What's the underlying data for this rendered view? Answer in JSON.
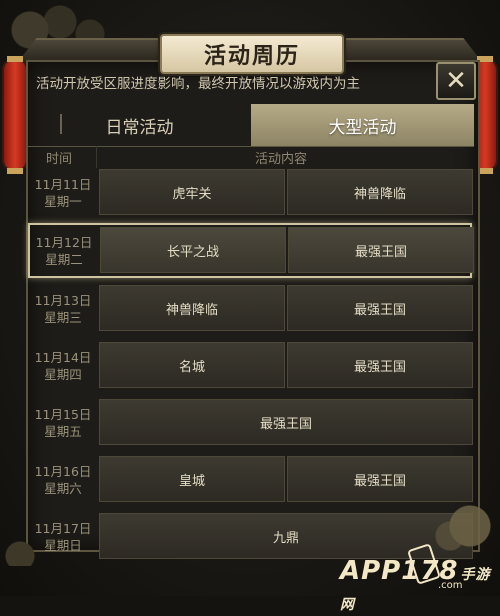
{
  "title": "活动周历",
  "notice": "活动开放受区服进度影响，最终开放情况以游戏内为主",
  "close_icon": "close-x-icon",
  "tabs": [
    {
      "label": "日常活动",
      "active": false
    },
    {
      "label": "大型活动",
      "active": true
    }
  ],
  "headers": {
    "time": "时间",
    "content": "活动内容"
  },
  "rows": [
    {
      "date": "11月11日",
      "weekday": "星期一",
      "events": [
        "虎牢关",
        "神兽降临"
      ]
    },
    {
      "date": "11月12日",
      "weekday": "星期二",
      "events": [
        "长平之战",
        "最强王国"
      ],
      "highlight": true
    },
    {
      "date": "11月13日",
      "weekday": "星期三",
      "events": [
        "神兽降临",
        "最强王国"
      ]
    },
    {
      "date": "11月14日",
      "weekday": "星期四",
      "events": [
        "名城",
        "最强王国"
      ]
    },
    {
      "date": "11月15日",
      "weekday": "星期五",
      "events": [
        "最强王国"
      ]
    },
    {
      "date": "11月16日",
      "weekday": "星期六",
      "events": [
        "皇城",
        "最强王国"
      ]
    },
    {
      "date": "11月17日",
      "weekday": "星期日",
      "events": [
        "九鼎"
      ]
    }
  ],
  "watermark": {
    "brand": "APP178",
    "suffix": "手游网",
    "domain": ".com"
  },
  "colors": {
    "accent": "#b6ab86",
    "lantern": "#d63a22",
    "text": "#e4dcc4"
  }
}
